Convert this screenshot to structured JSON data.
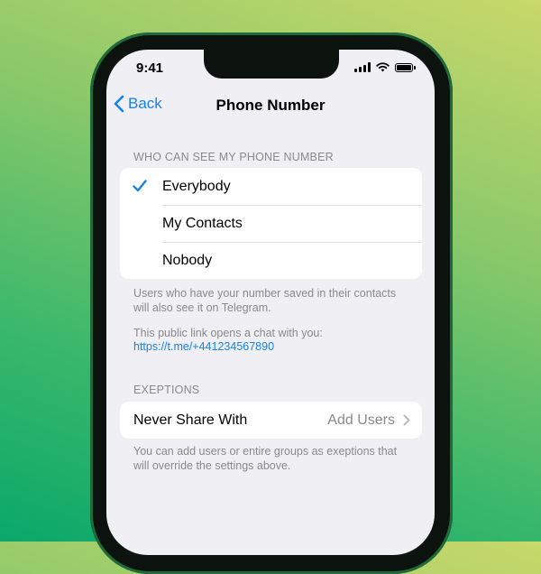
{
  "status_bar": {
    "time": "9:41"
  },
  "nav": {
    "back_label": "Back",
    "title": "Phone Number"
  },
  "visibility": {
    "header": "WHO CAN SEE MY PHONE NUMBER",
    "options": [
      {
        "label": "Everybody",
        "selected": true
      },
      {
        "label": "My Contacts",
        "selected": false
      },
      {
        "label": "Nobody",
        "selected": false
      }
    ],
    "footer_line1": "Users who have your number saved in their contacts",
    "footer_line2": "will also see it on Telegram.",
    "link_caption": "This public link opens a chat with you:",
    "link": "https://t.me/+441234567890"
  },
  "exceptions": {
    "header": "EXEPTIONS",
    "row_label": "Never Share With",
    "row_value": "Add Users",
    "footer_line1": "You can add users or entire groups as exeptions that",
    "footer_line2": "will override the settings above."
  },
  "colors": {
    "accent": "#1a82e2",
    "background": "#efeff4"
  }
}
